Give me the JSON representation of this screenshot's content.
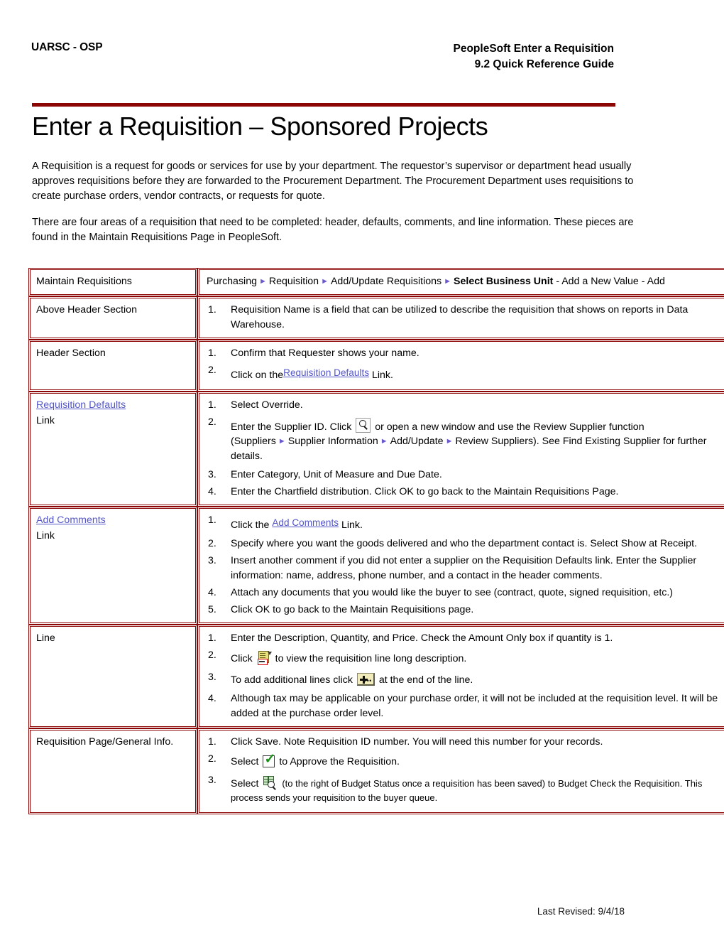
{
  "header": {
    "left": "UARSC - OSP",
    "right_line1": "PeopleSoft Enter a Requisition",
    "right_line2": "9.2 Quick Reference Guide"
  },
  "title": "Enter a Requisition – Sponsored Projects",
  "intro": {
    "paragraph1": "A Requisition is a request for goods or services for use by your department. The requestor’s supervisor or department head usually approves requisitions before they are forwarded to the Procurement Department. The Procurement Department uses requisitions to create purchase orders, vendor contracts, or requests for quote.",
    "paragraph2": "There are four areas of a requisition that need to be completed: header, defaults, comments, and line information. These pieces are found in the Maintain Requisitions Page in PeopleSoft."
  },
  "table": {
    "row_maintain": {
      "label": "Maintain Requisitions",
      "breadcrumb": {
        "item1": "Purchasing",
        "item2": "Requisition",
        "item3": "Add/Update Requisitions",
        "item4_bold": "Select Business Unit",
        "tail": " - Add a New Value - Add"
      }
    },
    "row_above_header": {
      "label": "Above Header Section",
      "steps": [
        "Requisition Name is a field that can be utilized to describe the requisition that shows on reports in Data Warehouse."
      ]
    },
    "row_header_section": {
      "label": "Header Section",
      "step1": "Confirm that Requester shows your name.",
      "step2_pre": "Click on the",
      "step2_link": "Requisition Defaults",
      "step2_post": "Link."
    },
    "row_req_defaults": {
      "label_link": "Requisition Defaults",
      "label_sub": "Link",
      "step1": "Select Override.",
      "step2_pre": "Enter the Supplier ID.  Click",
      "step2_icon": "lookup-icon",
      "step2_mid": "or open a new window and use the Review Supplier function (Suppliers",
      "step2_bc1": "Supplier Information",
      "step2_bc2": "Add/Update",
      "step2_bc3": "Review Suppliers).  See Find Existing Supplier for further details.",
      "step3": "Enter Category, Unit of Measure and Due Date.",
      "step4": "Enter the Chartfield distribution. Click OK to go back to the Maintain Requisitions Page."
    },
    "row_add_comments": {
      "label_link": "Add Comments",
      "label_sub": "Link",
      "step1_pre": "Click the",
      "step1_link": "Add Comments",
      "step1_post": "Link.",
      "step2": "Specify where you want the goods delivered and who the department contact is. Select Show at Receipt.",
      "step3": "Insert another comment if you did not enter a supplier on the Requisition Defaults link. Enter the Supplier information: name, address, phone number, and a contact in the header comments.",
      "step4": "Attach any documents that you would like the buyer to see (contract, quote, signed requisition, etc.)",
      "step5": "Click OK to go back to the Maintain Requisitions page."
    },
    "row_line": {
      "label": "Line",
      "step1": "Enter the Description, Quantity, and Price.  Check the Amount Only box if quantity is 1.",
      "step2_pre": "Click",
      "step2_icon": "long-description-icon",
      "step2_post": "to view the requisition line long description.",
      "step3_pre": "To add additional lines click",
      "step3_icon": "add-line-icon",
      "step3_post": "at the end of the line.",
      "step4": "Although tax may be applicable on your purchase order, it will not be included at the requisition level.  It will be added at the purchase order level."
    },
    "row_requisition_page": {
      "label": "Requisition Page/General Info.",
      "step1": "Click Save.  Note Requisition ID number.  You will need this number for your records.",
      "step2_pre": "Select",
      "step2_icon": "approve-check-icon",
      "step2_post": "to Approve the Requisition.",
      "step3_pre": "Select",
      "step3_icon": "budget-check-icon",
      "step3_note": "(to the right of Budget Status once a requisition has been saved) to Budget Check the",
      "step3_post": "Requisition.  This process sends your requisition to the buyer queue."
    }
  },
  "footer": {
    "last_revised": "Last Revised: 9/4/18"
  },
  "colors": {
    "accent_maroon": "#8c0606",
    "link_blue": "#5456c8",
    "breadcrumb_arrow": "#6a5acd"
  }
}
